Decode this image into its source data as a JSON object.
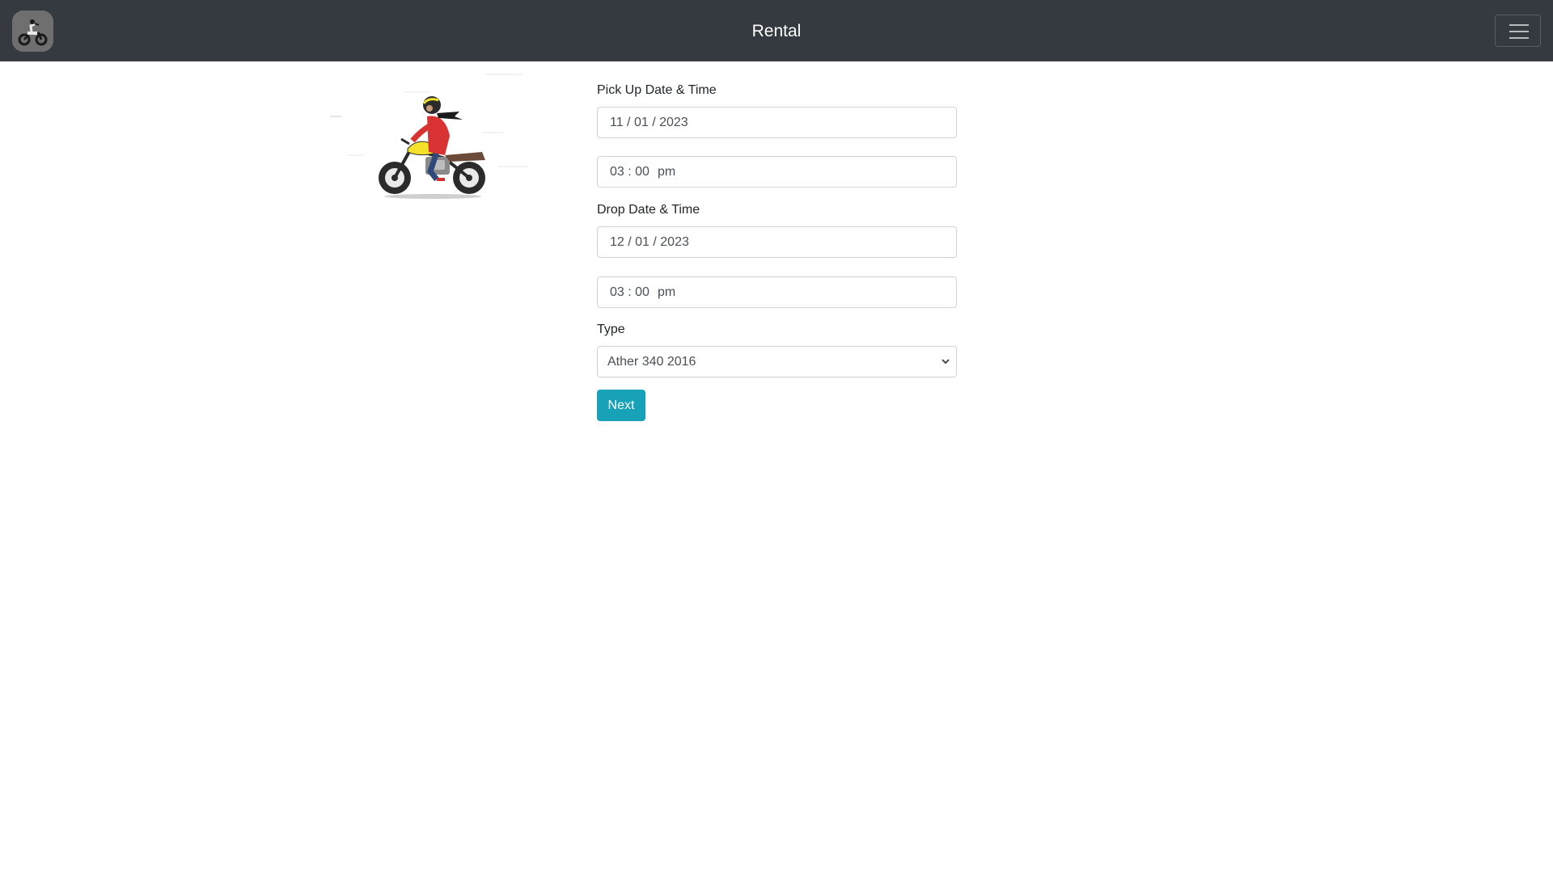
{
  "navbar": {
    "title": "Rental",
    "logo_icon": "motorcycle-rider-icon",
    "menu_icon": "hamburger-menu-icon",
    "background": "#343a40"
  },
  "illustration": {
    "icon": "motorcycle-rider-illustration"
  },
  "form": {
    "pickup": {
      "label": "Pick Up Date & Time",
      "date": "11 / 01 / 2023",
      "time": "03 : 00",
      "ampm": "pm"
    },
    "drop": {
      "label": "Drop Date & Time",
      "date": "12 / 01 / 2023",
      "time": "03 : 00",
      "ampm": "pm"
    },
    "type": {
      "label": "Type",
      "selected": "Ather 340 2016"
    },
    "next_label": "Next",
    "accent": "#17a2b8"
  }
}
